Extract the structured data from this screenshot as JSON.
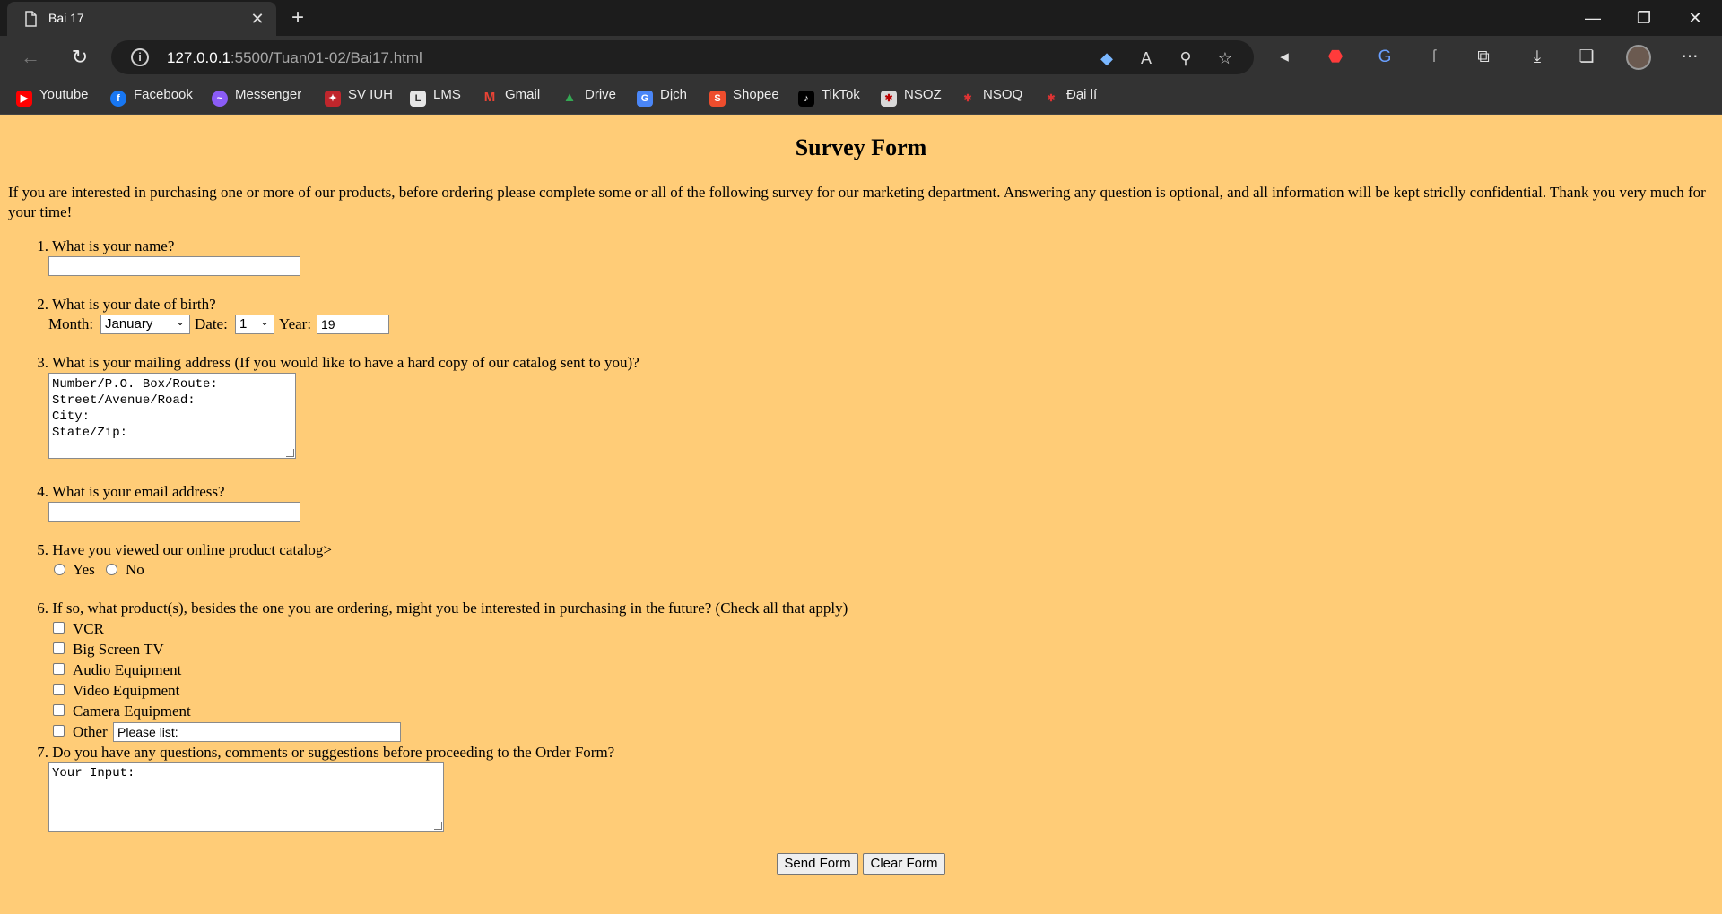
{
  "browser": {
    "tab_title": "Bai 17",
    "url_host": "127.0.0.1",
    "url_path": ":5500/Tuan01-02/Bai17.html",
    "bookmarks": [
      "Youtube",
      "Facebook",
      "Messenger",
      "SV IUH",
      "LMS",
      "Gmail",
      "Drive",
      "Dịch",
      "Shopee",
      "TikTok",
      "NSOZ",
      "NSOQ",
      "Đại lí"
    ]
  },
  "page": {
    "title": "Survey Form",
    "intro": "If you are interested in purchasing one or more of our products, before ordering please complete some or all of the following survey for our marketing department. Answering any question is optional, and all information will be kept striclly confidential. Thank you very much for your time!",
    "q1": {
      "num": "1.",
      "text": "What is your name?",
      "value": ""
    },
    "q2": {
      "num": "2.",
      "text": "What is your date of birth?",
      "month_label": "Month:",
      "month_value": "January",
      "date_label": "Date:",
      "date_value": "1",
      "year_label": "Year:",
      "year_value": "19"
    },
    "q3": {
      "num": "3.",
      "text": "What is your mailing address (If you would like to have a hard copy of our catalog sent to you)?",
      "value": "Number/P.O. Box/Route:\nStreet/Avenue/Road:\nCity:\nState/Zip:"
    },
    "q4": {
      "num": "4.",
      "text": "What is your email address?",
      "value": ""
    },
    "q5": {
      "num": "5.",
      "text": "Have you viewed our online product catalog>",
      "yes": "Yes",
      "no": "No"
    },
    "q6": {
      "num": "6.",
      "text": "If so, what product(s), besides the one you are ordering, might you be interested in purchasing in the future? (Check all that apply)",
      "options": [
        "VCR",
        "Big Screen TV",
        "Audio Equipment",
        "Video Equipment",
        "Camera Equipment",
        "Other"
      ],
      "other_value": "Please list:"
    },
    "q7": {
      "num": "7.",
      "text": "Do you have any questions, comments or suggestions before proceeding to the Order Form?",
      "value": "Your Input:"
    },
    "send_label": "Send Form",
    "clear_label": "Clear Form"
  }
}
